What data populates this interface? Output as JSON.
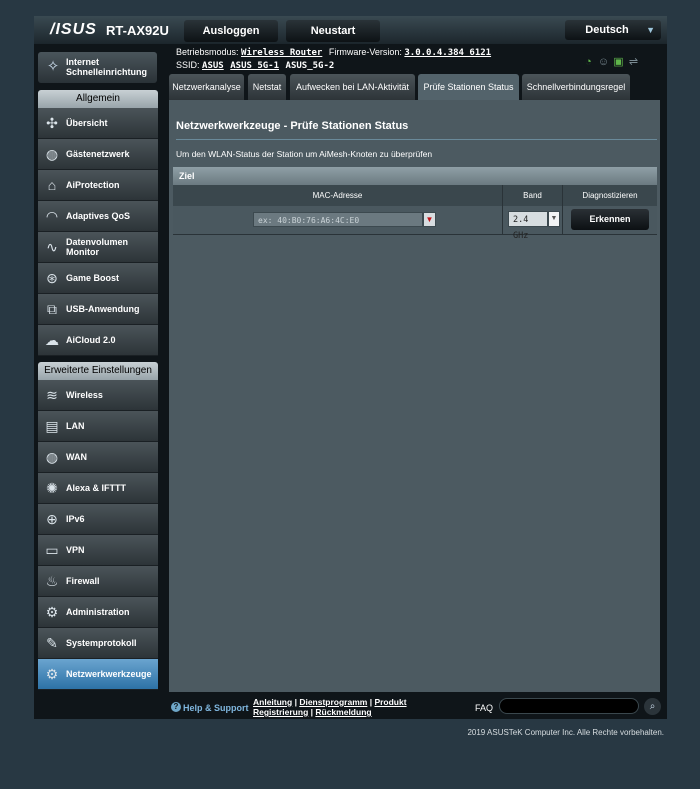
{
  "header": {
    "logo": "/ISUS",
    "model": "RT-AX92U",
    "logout_label": "Ausloggen",
    "restart_label": "Neustart",
    "language": "Deutsch"
  },
  "info": {
    "mode_label": "Betriebsmodus:",
    "mode_value": "Wireless Router",
    "firmware_label": "Firmware-Version:",
    "firmware_value": "3.0.0.4.384_6121",
    "ssid_label": "SSID:",
    "ssids": [
      "ASUS",
      "ASUS_5G-1",
      "ASUS_5G-2"
    ]
  },
  "status_icons": [
    "speedometer-icon",
    "users-icon",
    "devices-icon",
    "usb-icon"
  ],
  "sidebar": {
    "qis_label": "Internet Schnelleinrichtung",
    "general_title": "Allgemein",
    "general_items": [
      {
        "label": "Übersicht",
        "icon": "network-map-icon"
      },
      {
        "label": "Gästenetzwerk",
        "icon": "globe-icon"
      },
      {
        "label": "AiProtection",
        "icon": "lock-icon"
      },
      {
        "label": "Adaptives QoS",
        "icon": "gauge-icon"
      },
      {
        "label": "Datenvolumen Monitor",
        "icon": "chart-icon"
      },
      {
        "label": "Game Boost",
        "icon": "gamepad-icon"
      },
      {
        "label": "USB-Anwendung",
        "icon": "puzzle-icon"
      },
      {
        "label": "AiCloud 2.0",
        "icon": "cloud-icon"
      }
    ],
    "advanced_title": "Erweiterte Einstellungen",
    "advanced_items": [
      {
        "label": "Wireless",
        "icon": "wifi-icon"
      },
      {
        "label": "LAN",
        "icon": "lan-icon"
      },
      {
        "label": "WAN",
        "icon": "globe-icon"
      },
      {
        "label": "Alexa & IFTTT",
        "icon": "assistant-icon"
      },
      {
        "label": "IPv6",
        "icon": "ipv6-icon"
      },
      {
        "label": "VPN",
        "icon": "vpn-icon"
      },
      {
        "label": "Firewall",
        "icon": "firewall-icon"
      },
      {
        "label": "Administration",
        "icon": "admin-icon"
      },
      {
        "label": "Systemprotokoll",
        "icon": "log-icon"
      },
      {
        "label": "Netzwerkwerkzeuge",
        "icon": "tools-icon",
        "active": true
      }
    ]
  },
  "tabs": [
    {
      "label": "Netzwerkanalyse"
    },
    {
      "label": "Netstat"
    },
    {
      "label": "Aufwecken bei LAN-Aktivität"
    },
    {
      "label": "Prüfe Stationen Status",
      "active": true
    },
    {
      "label": "Schnellverbindungsregel"
    }
  ],
  "main": {
    "title": "Netzwerkwerkzeuge - Prüfe Stationen Status",
    "description": "Um den WLAN-Status der Station um AiMesh-Knoten zu überprüfen",
    "section": "Ziel",
    "columns": [
      "MAC-Adresse",
      "Band",
      "Diagnostizieren"
    ],
    "mac_placeholder": "ex: 40:B0:76:A6:4C:E0",
    "band_value": "2.4 GHz",
    "detect_label": "Erkennen"
  },
  "footer": {
    "help_label": "Help & Support",
    "links": [
      "Anleitung",
      "Dienstprogramm",
      "Produkt Registrierung",
      "Rückmeldung"
    ],
    "faq_label": "FAQ"
  },
  "copyright": "2019 ASUSTeK Computer Inc. Alle Rechte vorbehalten."
}
